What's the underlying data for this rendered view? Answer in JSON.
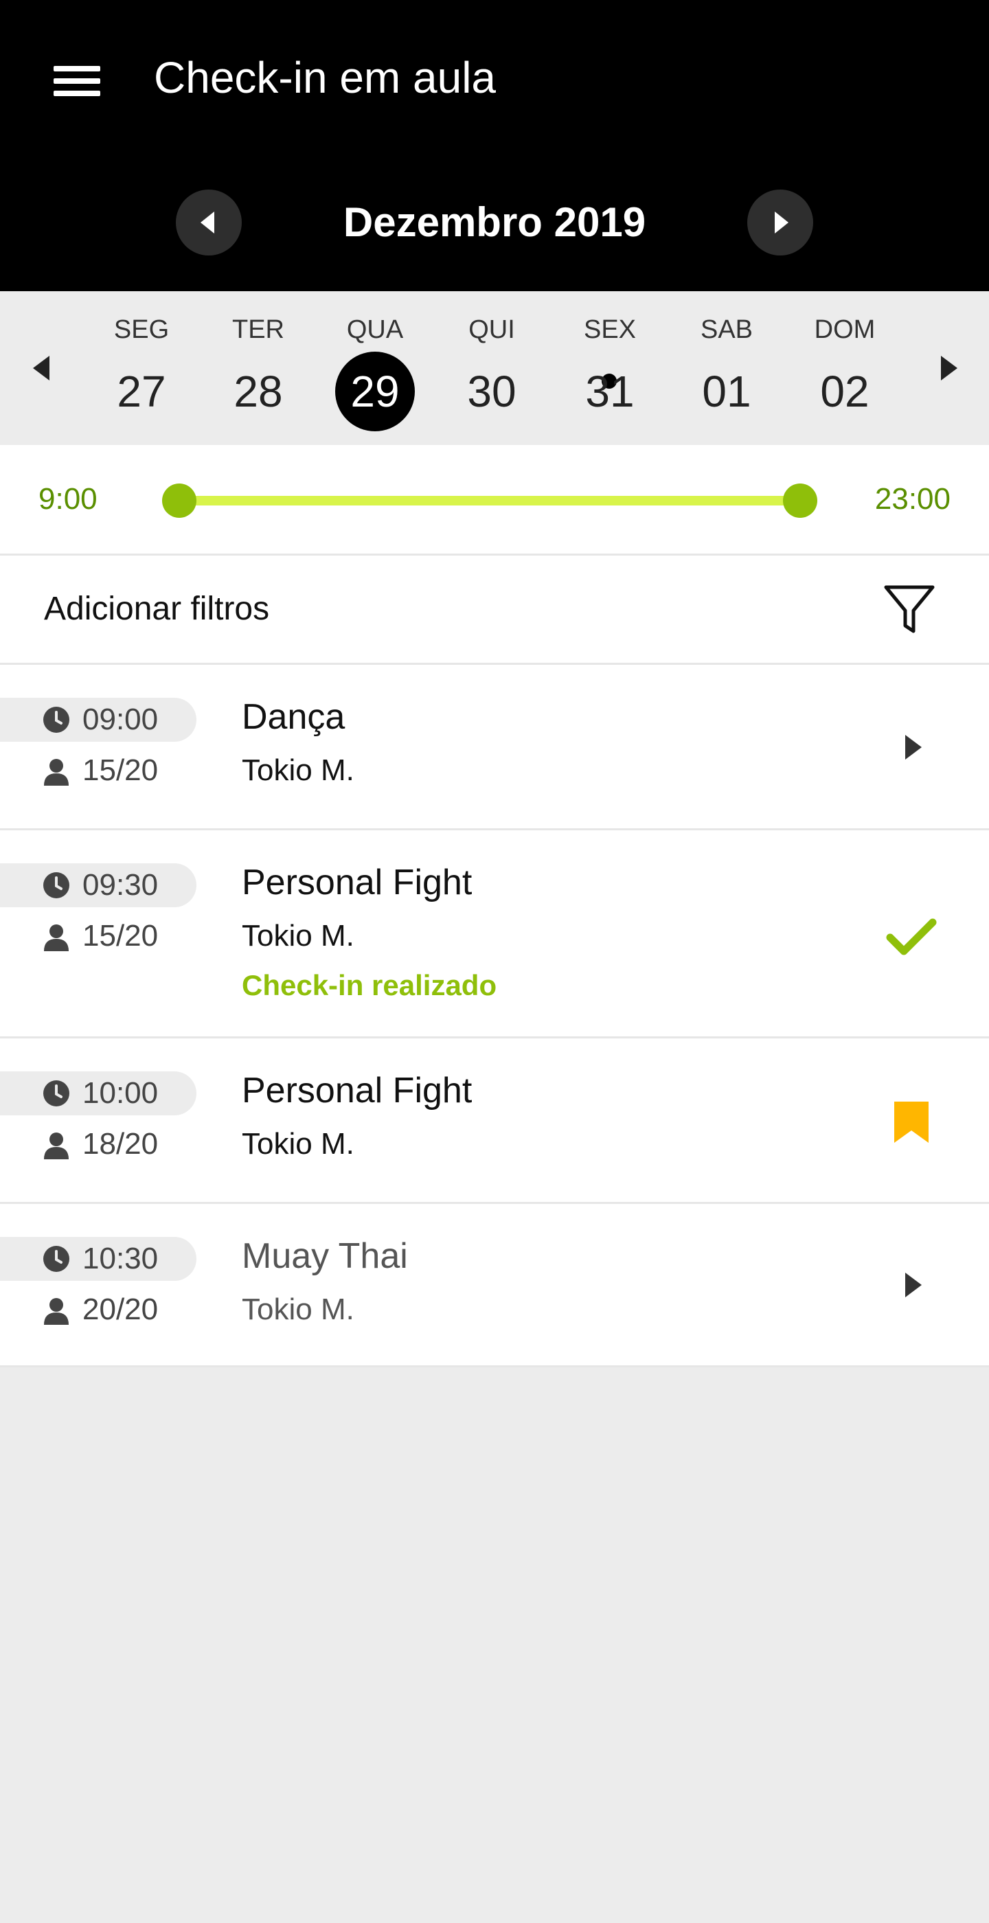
{
  "header": {
    "title": "Check-in em aula",
    "month_label": "Dezembro 2019"
  },
  "week": {
    "days": [
      {
        "name": "SEG",
        "number": "27",
        "selected": false,
        "has_event": false
      },
      {
        "name": "TER",
        "number": "28",
        "selected": false,
        "has_event": false
      },
      {
        "name": "QUA",
        "number": "29",
        "selected": true,
        "has_event": false
      },
      {
        "name": "QUI",
        "number": "30",
        "selected": false,
        "has_event": false
      },
      {
        "name": "SEX",
        "number": "31",
        "selected": false,
        "has_event": true
      },
      {
        "name": "SAB",
        "number": "01",
        "selected": false,
        "has_event": false
      },
      {
        "name": "DOM",
        "number": "02",
        "selected": false,
        "has_event": false
      }
    ]
  },
  "time_range": {
    "start": "9:00",
    "end": "23:00",
    "accent_color": "#8fbf0a",
    "track_color": "#d8f44a"
  },
  "filters": {
    "label": "Adicionar filtros",
    "icon": "funnel-icon"
  },
  "classes": [
    {
      "time": "09:00",
      "capacity": "15/20",
      "name": "Dança",
      "teacher": "Tokio M.",
      "status": "",
      "action_icon": "chevron-right-icon"
    },
    {
      "time": "09:30",
      "capacity": "15/20",
      "name": "Personal Fight",
      "teacher": "Tokio M.",
      "status": "Check-in realizado",
      "action_icon": "checkmark-icon"
    },
    {
      "time": "10:00",
      "capacity": "18/20",
      "name": "Personal Fight",
      "teacher": "Tokio M.",
      "status": "",
      "action_icon": "bookmark-icon"
    },
    {
      "time": "10:30",
      "capacity": "20/20",
      "name": "Muay Thai",
      "teacher": "Tokio M.",
      "status": "",
      "action_icon": "chevron-right-icon"
    }
  ],
  "colors": {
    "checkin_green": "#8fbf0a",
    "bookmark_yellow": "#ffb600",
    "header_bg": "#000000"
  }
}
